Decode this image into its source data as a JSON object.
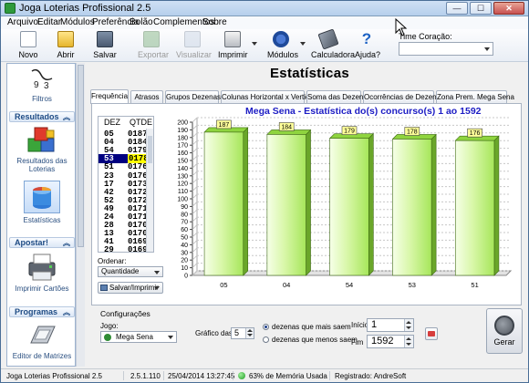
{
  "window": {
    "title": "Joga Loterias Profissional 2.5",
    "controls": {
      "minimize": "—",
      "maximize": "☐",
      "close": "✕"
    }
  },
  "menu": [
    "Arquivo",
    "Editar",
    "Módulos",
    "Preferência",
    "Bolão",
    "Complementos",
    "Sobre"
  ],
  "toolbar": {
    "items": [
      {
        "label": "Novo",
        "icon": "new-document-icon",
        "enabled": true
      },
      {
        "label": "Abrir",
        "icon": "folder-open-icon",
        "enabled": true
      },
      {
        "label": "Salvar",
        "icon": "floppy-disk-icon",
        "enabled": true
      },
      {
        "label": "Exportar",
        "icon": "export-icon",
        "enabled": false
      },
      {
        "label": "Visualizar",
        "icon": "preview-icon",
        "enabled": false
      },
      {
        "label": "Imprimir",
        "icon": "printer-icon",
        "enabled": true
      },
      {
        "label": "Módulos",
        "icon": "modules-icon",
        "enabled": true
      },
      {
        "label": "Calculadora",
        "icon": "calculator-icon",
        "enabled": true
      },
      {
        "label": "Ajuda?",
        "icon": "help-icon",
        "enabled": true
      }
    ],
    "time_label": "Time Coração:",
    "time_value": ""
  },
  "sidebar": {
    "top_item": {
      "label": "Filtros",
      "icon": "filters-icon"
    },
    "groups": [
      {
        "title": "Resultados",
        "items": [
          {
            "label": "Resultados das Loterias",
            "icon": "cubes-icon"
          },
          {
            "label": "Estatísticas",
            "icon": "statistics-icon",
            "selected": true
          }
        ]
      },
      {
        "title": "Apostar!",
        "items": [
          {
            "label": "Imprimir Cartões",
            "icon": "card-printer-icon"
          }
        ]
      },
      {
        "title": "Programas",
        "items": [
          {
            "label": "Editor de Matrizes",
            "icon": "matrix-editor-icon"
          }
        ]
      }
    ]
  },
  "main": {
    "heading": "Estatísticas",
    "tabs": [
      "Frequência",
      "Atrasos",
      "Grupos Dezenas",
      "Colunas Horizontal x Vertical",
      "Soma das Dezenas",
      "Ocorrências de Dezenas",
      "Zona Prem. Mega Sena"
    ],
    "active_tab": 0,
    "list": {
      "headers": {
        "dez": "DEZ",
        "qtde": "QTDE"
      },
      "rows": [
        {
          "dez": "05",
          "qtde": "0187"
        },
        {
          "dez": "04",
          "qtde": "0184"
        },
        {
          "dez": "54",
          "qtde": "0179"
        },
        {
          "dez": "53",
          "qtde": "0178",
          "selected": true
        },
        {
          "dez": "51",
          "qtde": "0176"
        },
        {
          "dez": "23",
          "qtde": "0176"
        },
        {
          "dez": "17",
          "qtde": "0173"
        },
        {
          "dez": "42",
          "qtde": "0172"
        },
        {
          "dez": "52",
          "qtde": "0172"
        },
        {
          "dez": "49",
          "qtde": "0171"
        },
        {
          "dez": "24",
          "qtde": "0171"
        },
        {
          "dez": "28",
          "qtde": "0170"
        },
        {
          "dez": "13",
          "qtde": "0170"
        },
        {
          "dez": "41",
          "qtde": "0169"
        },
        {
          "dez": "29",
          "qtde": "0169"
        }
      ]
    },
    "ordenar_label": "Ordenar:",
    "ordenar_value": "Quantidade",
    "save_print_label": "Salvar/Imprimir"
  },
  "chart_data": {
    "type": "bar",
    "title": "Mega Sena - Estatística do(s) concurso(s) 1 ao 1592",
    "categories": [
      "05",
      "04",
      "54",
      "53",
      "51"
    ],
    "values": [
      187,
      184,
      179,
      178,
      176
    ],
    "data_labels": [
      "187",
      "184",
      "179",
      "178",
      "176"
    ],
    "ylim": [
      0,
      200
    ],
    "yticks": [
      "0",
      "10",
      "20",
      "30",
      "40",
      "50",
      "60",
      "70",
      "80",
      "90",
      "100",
      "110",
      "120",
      "130",
      "140",
      "150",
      "160",
      "170",
      "180",
      "190",
      "200"
    ],
    "grid": true,
    "bar_color": "#a6e65a",
    "label_box_color": "#ffff99"
  },
  "config": {
    "section_label": "Configurações",
    "jogo_label": "Jogo:",
    "jogo_value": "Mega Sena",
    "grafico_label": "Gráfico das",
    "grafico_value": "5",
    "radio_more": "dezenas que mais saem",
    "radio_less": "dezenas que menos saem",
    "radio_selected": "more",
    "inicio_label": "Início",
    "inicio_value": "1",
    "fim_label": "Fim",
    "fim_value": "1592",
    "gerar_label": "Gerar"
  },
  "statusbar": {
    "app": "Joga Loterias Profissional 2.5",
    "version": "2.5.1.110",
    "datetime": "25/04/2014 13:27:45",
    "memory": "63% de Memória Usada",
    "registered": "Registrado: AndreSoft"
  }
}
